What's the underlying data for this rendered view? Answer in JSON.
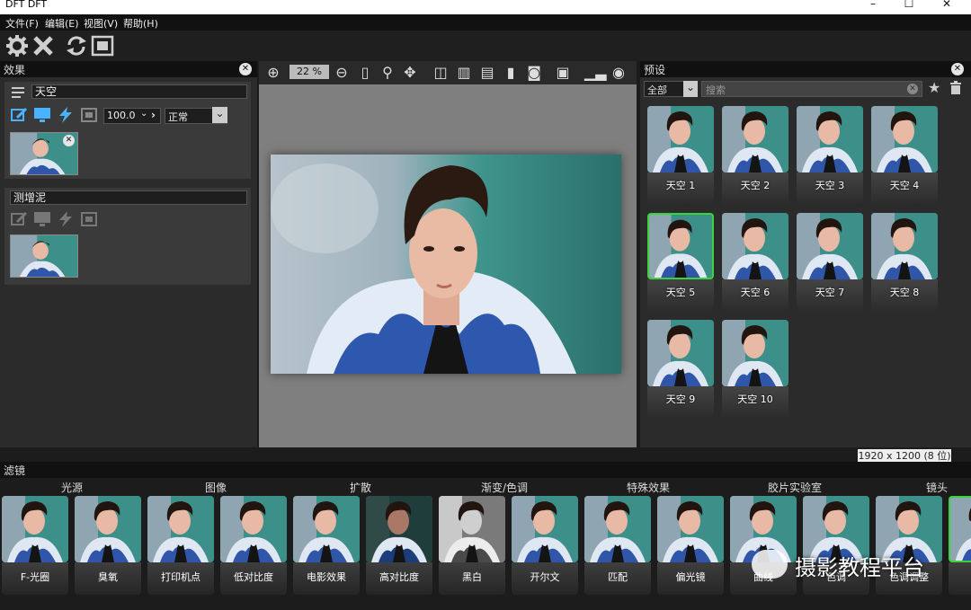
{
  "window": {
    "title": "DFT DFT",
    "min": "–",
    "max": "☐",
    "close": "✕"
  },
  "menu": [
    {
      "label": "文件(F)"
    },
    {
      "label": "编辑(E)"
    },
    {
      "label": "视图(V)"
    },
    {
      "label": "帮助(H)"
    }
  ],
  "toolbar": {
    "icons": [
      "gear-icon",
      "close-icon",
      "refresh-icon",
      "fit-screen-icon"
    ]
  },
  "effects_panel": {
    "title": "效果",
    "layer1": {
      "name": "天空",
      "opacity": "100.0",
      "blend": "正常"
    },
    "layer2": {
      "name": "测增泥"
    }
  },
  "viewer": {
    "zoom": "22 %"
  },
  "presets_panel": {
    "title": "预设",
    "category": "全部",
    "search_placeholder": "搜索",
    "items": [
      {
        "label": "天空 1"
      },
      {
        "label": "天空 2"
      },
      {
        "label": "天空 3"
      },
      {
        "label": "天空 4"
      },
      {
        "label": "天空 5"
      },
      {
        "label": "天空 6"
      },
      {
        "label": "天空 7"
      },
      {
        "label": "天空 8"
      },
      {
        "label": "天空 9"
      },
      {
        "label": "天空 10"
      }
    ],
    "selected_index": 4
  },
  "status": {
    "resolution": "1920 x 1200 (8 位)"
  },
  "filters": {
    "title": "滤镜",
    "categories": [
      {
        "label": "光源"
      },
      {
        "label": "图像"
      },
      {
        "label": "扩散"
      },
      {
        "label": "渐变/色调"
      },
      {
        "label": "特殊效果"
      },
      {
        "label": "胶片实验室"
      },
      {
        "label": "镜头"
      }
    ],
    "items": [
      {
        "label": "F-光圈"
      },
      {
        "label": "臭氧"
      },
      {
        "label": "打印机点"
      },
      {
        "label": "低对比度"
      },
      {
        "label": "电影效果"
      },
      {
        "label": "高对比度"
      },
      {
        "label": "黑白"
      },
      {
        "label": "开尔文"
      },
      {
        "label": "匹配"
      },
      {
        "label": "偏光镜"
      },
      {
        "label": "曲线"
      },
      {
        "label": "色调"
      },
      {
        "label": "色调调整"
      },
      {
        "label": ""
      }
    ]
  },
  "watermark": {
    "text": "摄影教程平台"
  },
  "colors": {
    "accent_selected": "#3cd23c",
    "panel_bg": "#3a3a3a",
    "viewer_bg": "#7f7f7f"
  }
}
